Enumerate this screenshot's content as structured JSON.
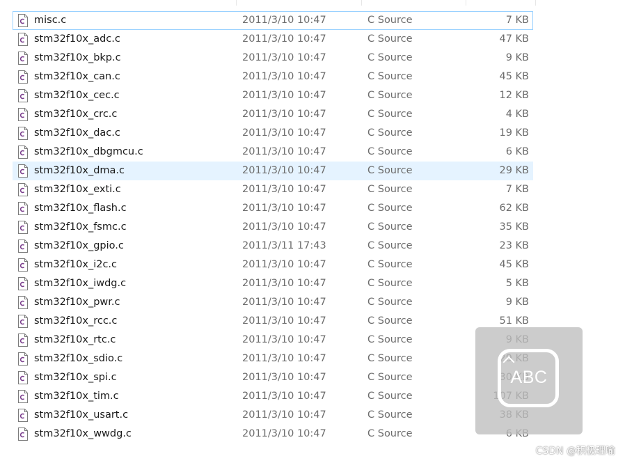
{
  "files": [
    {
      "name": "misc.c",
      "modified": "2011/3/10 10:47",
      "type": "C Source",
      "size": "7 KB"
    },
    {
      "name": "stm32f10x_adc.c",
      "modified": "2011/3/10 10:47",
      "type": "C Source",
      "size": "47 KB"
    },
    {
      "name": "stm32f10x_bkp.c",
      "modified": "2011/3/10 10:47",
      "type": "C Source",
      "size": "9 KB"
    },
    {
      "name": "stm32f10x_can.c",
      "modified": "2011/3/10 10:47",
      "type": "C Source",
      "size": "45 KB"
    },
    {
      "name": "stm32f10x_cec.c",
      "modified": "2011/3/10 10:47",
      "type": "C Source",
      "size": "12 KB"
    },
    {
      "name": "stm32f10x_crc.c",
      "modified": "2011/3/10 10:47",
      "type": "C Source",
      "size": "4 KB"
    },
    {
      "name": "stm32f10x_dac.c",
      "modified": "2011/3/10 10:47",
      "type": "C Source",
      "size": "19 KB"
    },
    {
      "name": "stm32f10x_dbgmcu.c",
      "modified": "2011/3/10 10:47",
      "type": "C Source",
      "size": "6 KB"
    },
    {
      "name": "stm32f10x_dma.c",
      "modified": "2011/3/10 10:47",
      "type": "C Source",
      "size": "29 KB"
    },
    {
      "name": "stm32f10x_exti.c",
      "modified": "2011/3/10 10:47",
      "type": "C Source",
      "size": "7 KB"
    },
    {
      "name": "stm32f10x_flash.c",
      "modified": "2011/3/10 10:47",
      "type": "C Source",
      "size": "62 KB"
    },
    {
      "name": "stm32f10x_fsmc.c",
      "modified": "2011/3/10 10:47",
      "type": "C Source",
      "size": "35 KB"
    },
    {
      "name": "stm32f10x_gpio.c",
      "modified": "2011/3/11 17:43",
      "type": "C Source",
      "size": "23 KB"
    },
    {
      "name": "stm32f10x_i2c.c",
      "modified": "2011/3/10 10:47",
      "type": "C Source",
      "size": "45 KB"
    },
    {
      "name": "stm32f10x_iwdg.c",
      "modified": "2011/3/10 10:47",
      "type": "C Source",
      "size": "5 KB"
    },
    {
      "name": "stm32f10x_pwr.c",
      "modified": "2011/3/10 10:47",
      "type": "C Source",
      "size": "9 KB"
    },
    {
      "name": "stm32f10x_rcc.c",
      "modified": "2011/3/10 10:47",
      "type": "C Source",
      "size": "51 KB"
    },
    {
      "name": "stm32f10x_rtc.c",
      "modified": "2011/3/10 10:47",
      "type": "C Source",
      "size": "9 KB"
    },
    {
      "name": "stm32f10x_sdio.c",
      "modified": "2011/3/10 10:47",
      "type": "C Source",
      "size": "29 KB"
    },
    {
      "name": "stm32f10x_spi.c",
      "modified": "2011/3/10 10:47",
      "type": "C Source",
      "size": "30 KB"
    },
    {
      "name": "stm32f10x_tim.c",
      "modified": "2011/3/10 10:47",
      "type": "C Source",
      "size": "107 KB"
    },
    {
      "name": "stm32f10x_usart.c",
      "modified": "2011/3/10 10:47",
      "type": "C Source",
      "size": "38 KB"
    },
    {
      "name": "stm32f10x_wwdg.c",
      "modified": "2011/3/10 10:47",
      "type": "C Source",
      "size": "6 KB"
    }
  ],
  "focused_index": 0,
  "hovered_index": 8,
  "file_icon": "c-source-file-icon",
  "overlay": {
    "text": "ABC",
    "icon": "input-method-icon"
  },
  "watermark": "CSDN @积极理喻",
  "colors": {
    "hover": "#e5f3ff",
    "focus_border": "#99d1ff",
    "icon_accent": "#7a3d8c"
  }
}
